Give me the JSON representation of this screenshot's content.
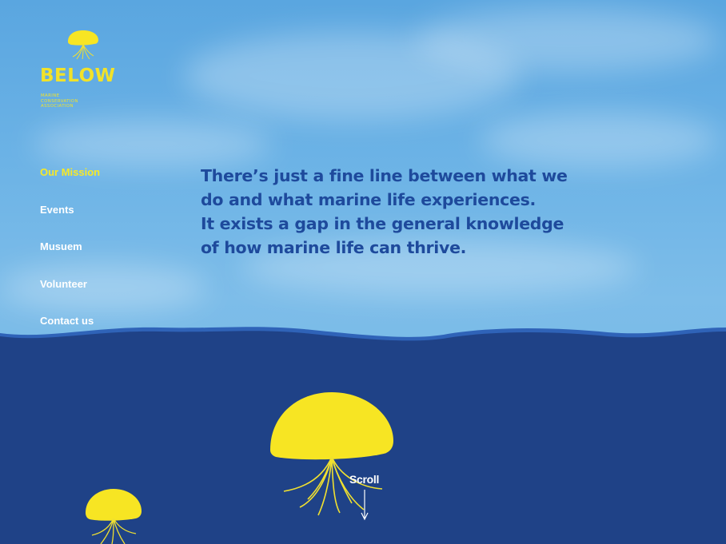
{
  "brand": {
    "name": "BELOW",
    "tagline_lines": [
      "Marine",
      "Conservation",
      "Association"
    ],
    "logo_icon": "jellyfish-icon"
  },
  "nav": {
    "items": [
      {
        "label": "Our Mission",
        "active": true
      },
      {
        "label": "Events",
        "active": false
      },
      {
        "label": "Musuem",
        "active": false
      },
      {
        "label": "Volunteer",
        "active": false
      },
      {
        "label": "Contact us",
        "active": false
      }
    ]
  },
  "hero": {
    "lines": [
      "There’s just a fine line between what we",
      "do and what marine life experiences.",
      "It exists a gap in the general knowledge",
      "of how marine life can thrive."
    ]
  },
  "scroll": {
    "label": "Scroll",
    "icon": "arrow-down-icon"
  },
  "colors": {
    "sky": "#6cb3e6",
    "sea": "#1f4287",
    "wave_edge": "#2f63b8",
    "accent_yellow": "#f7e523",
    "headline": "#1e4a9c",
    "nav_text": "#ffffff"
  }
}
